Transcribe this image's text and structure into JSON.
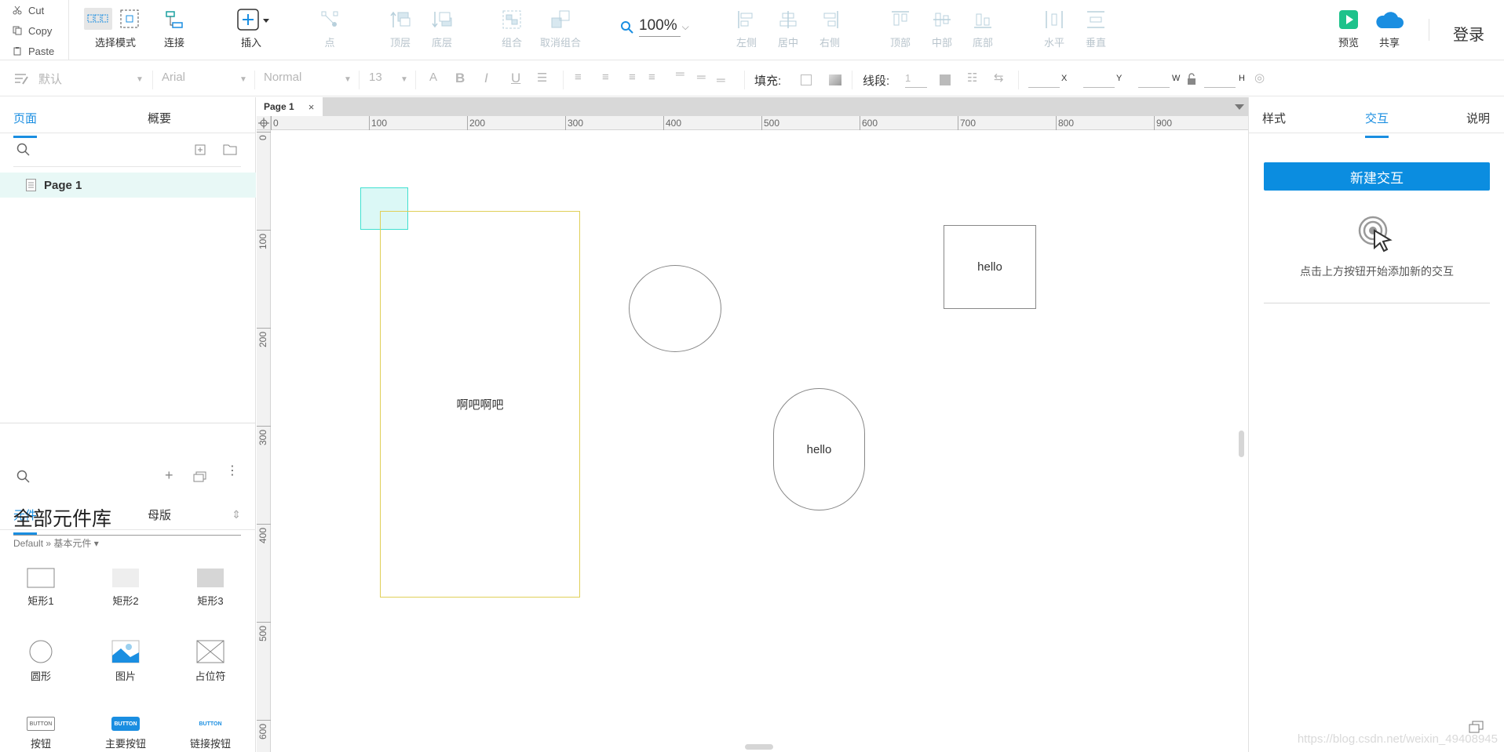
{
  "clipboard": {
    "cut": "Cut",
    "copy": "Copy",
    "paste": "Paste"
  },
  "toolbar": {
    "select_mode": "选择模式",
    "connect": "连接",
    "insert": "插入",
    "point": "点",
    "top_layer": "顶层",
    "bottom_layer": "底层",
    "group": "组合",
    "ungroup": "取消组合",
    "zoom": "100%",
    "align_left": "左侧",
    "align_center": "居中",
    "align_right": "右侧",
    "align_top": "顶部",
    "align_middle": "中部",
    "align_bottom": "底部",
    "dist_horizontal": "水平",
    "dist_vertical": "垂直",
    "preview": "预览",
    "share": "共享",
    "login": "登录"
  },
  "format": {
    "style": "默认",
    "font": "Arial",
    "weight": "Normal",
    "size": "13",
    "fill_label": "填充:",
    "stroke_label": "线段:",
    "stroke_value": "1",
    "x_label": "X",
    "y_label": "Y",
    "w_label": "W",
    "h_label": "H"
  },
  "left_panel": {
    "tabs": [
      "页面",
      "概要"
    ],
    "active_tab": "页面",
    "pages": [
      {
        "name": "Page 1"
      }
    ],
    "lib_tabs": [
      "元件",
      "母版"
    ],
    "active_lib_tab": "元件",
    "library_name": "全部元件库",
    "breadcrumb": "Default » 基本元件 ▾",
    "widgets": [
      {
        "label": "矩形1",
        "icon": "rect-outline-icon"
      },
      {
        "label": "矩形2",
        "icon": "rect-light-fill-icon"
      },
      {
        "label": "矩形3",
        "icon": "rect-gray-fill-icon"
      },
      {
        "label": "圆形",
        "icon": "circle-icon"
      },
      {
        "label": "图片",
        "icon": "image-icon"
      },
      {
        "label": "占位符",
        "icon": "placeholder-icon"
      },
      {
        "label": "按钮",
        "icon": "button-icon",
        "thumb": "BUTTON"
      },
      {
        "label": "主要按钮",
        "icon": "primary-button-icon",
        "thumb": "BUTTON"
      },
      {
        "label": "链接按钮",
        "icon": "link-button-icon",
        "thumb": "BUTTON"
      }
    ]
  },
  "canvas": {
    "tab_label": "Page 1",
    "ruler_h": [
      "0",
      "100",
      "200",
      "300",
      "400",
      "500",
      "600",
      "700",
      "800",
      "900"
    ],
    "ruler_v": [
      "0",
      "100",
      "200",
      "300",
      "400",
      "500",
      "600"
    ],
    "shapes": {
      "rect_text": "啊吧啊吧",
      "square_text": "hello",
      "pill_text": "hello"
    },
    "colors": {
      "selection": "#40e0d0",
      "highlight_rect": "#e0cf58",
      "shape_border": "#888888"
    }
  },
  "right_panel": {
    "tabs": [
      "样式",
      "交互",
      "说明"
    ],
    "active_tab": "交互",
    "new_button": "新建交互",
    "hint": "点击上方按钮开始添加新的交互"
  },
  "watermark": "https://blog.csdn.net/weixin_49408945",
  "accent_color": "#0b8de0"
}
